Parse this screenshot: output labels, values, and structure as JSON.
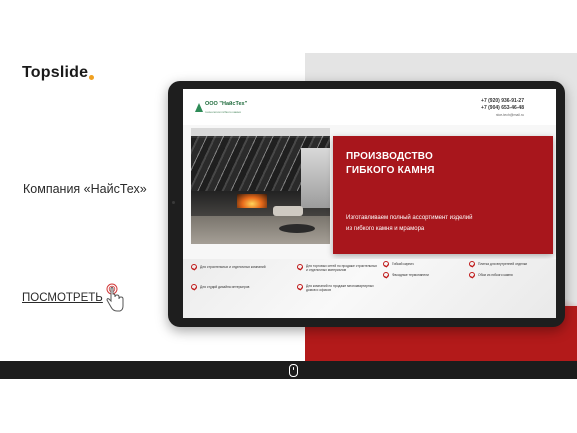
{
  "brand": {
    "name": "Topslide",
    "accent": "#f0a020"
  },
  "main": {
    "company": "Компания «НайсТех»",
    "view_label": "ПОСМОТРЕТЬ"
  },
  "site": {
    "logo_title": "ООО \"НайсТех\"",
    "logo_subtitle": "технологии гибкого камня",
    "phone1": "+7 (920) 936-91-27",
    "phone2": "+7 (904) 653-46-48",
    "email": "nice-tech@mail.ru",
    "hero_title_1": "ПРОИЗВОДСТВО",
    "hero_title_2": "ГИБКОГО КАМНЯ",
    "hero_sub_1": "Изготавливаем полный ассортимент изделий",
    "hero_sub_2": "из гибкого камня и мрамора",
    "features": [
      "Для строительных и отделочных компаний",
      "Для торговых сетей по продаже строительных и отделочных материалов",
      "Гибкий кирпич",
      "Плитка для внутренней отделки",
      "Фасадные термопанели",
      "Обои из гибкого камня",
      "Для студий дизайна интерьеров",
      "Для компаний по продаже многоквартирных домов и офисов"
    ]
  },
  "colors": {
    "red": "#b31a1a",
    "dark_band": "#1c1c1c",
    "gray": "#e4e4e4"
  },
  "icons": [
    "hand-pointer-icon",
    "mouse-scroll-icon",
    "checkmark-icon"
  ]
}
